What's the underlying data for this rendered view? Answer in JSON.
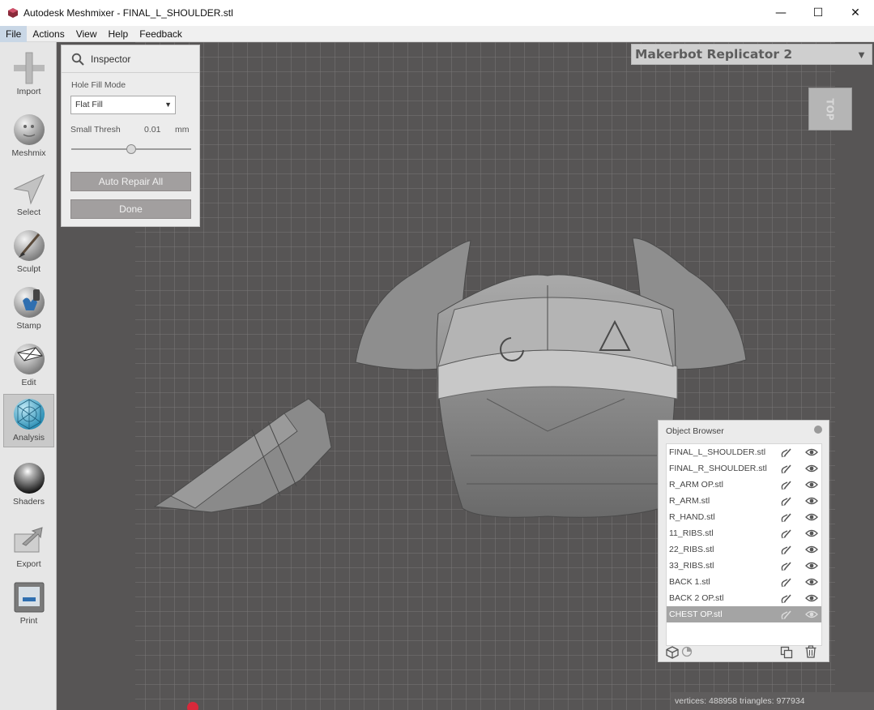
{
  "window": {
    "title": "Autodesk Meshmixer - FINAL_L_SHOULDER.stl",
    "minimize_glyph": "—",
    "maximize_glyph": "☐",
    "close_glyph": "✕"
  },
  "menu": {
    "items": [
      {
        "label": "File",
        "active": true
      },
      {
        "label": "Actions"
      },
      {
        "label": "View"
      },
      {
        "label": "Help"
      },
      {
        "label": "Feedback"
      }
    ]
  },
  "toolbar": {
    "items": [
      {
        "label": "Import",
        "icon": "plus-icon"
      },
      {
        "label": "Meshmix",
        "icon": "meshmix-bunny-icon"
      },
      {
        "label": "Select",
        "icon": "select-arrow-icon"
      },
      {
        "label": "Sculpt",
        "icon": "sculpt-brush-icon"
      },
      {
        "label": "Stamp",
        "icon": "stamp-icon"
      },
      {
        "label": "Edit",
        "icon": "edit-mesh-icon"
      },
      {
        "label": "Analysis",
        "icon": "analysis-mesh-icon",
        "active": true
      },
      {
        "label": "Shaders",
        "icon": "shader-sphere-icon"
      },
      {
        "label": "Export",
        "icon": "export-icon"
      },
      {
        "label": "Print",
        "icon": "print-icon"
      }
    ]
  },
  "printer": {
    "name": "Makerbot Replicator 2",
    "arrow": "▼"
  },
  "viewcube": {
    "face": "TOP"
  },
  "inspector": {
    "title": "Inspector",
    "hole_fill_mode_label": "Hole Fill Mode",
    "hole_fill_mode_value": "Flat Fill",
    "small_thresh_label": "Small Thresh",
    "small_thresh_value": "0.01",
    "small_thresh_unit": "mm",
    "small_thresh_slider_fraction": 0.5,
    "auto_repair_label": "Auto Repair All",
    "done_label": "Done"
  },
  "object_browser": {
    "title": "Object Browser",
    "objects": [
      {
        "name": "FINAL_L_SHOULDER.stl"
      },
      {
        "name": "FINAL_R_SHOULDER.stl"
      },
      {
        "name": "R_ARM OP.stl"
      },
      {
        "name": "R_ARM.stl"
      },
      {
        "name": "R_HAND.stl"
      },
      {
        "name": "11_RIBS.stl"
      },
      {
        "name": "22_RIBS.stl"
      },
      {
        "name": "33_RIBS.stl"
      },
      {
        "name": "BACK 1.stl"
      },
      {
        "name": "BACK 2 OP.stl"
      },
      {
        "name": "CHEST OP.stl",
        "selected": true
      }
    ]
  },
  "status": {
    "text": "vertices: 488958 triangles: 977934"
  },
  "colors": {
    "viewport_bg": "#575555",
    "grid_line": "#7a7878",
    "selected_row": "#a4a4a4",
    "button_bg": "#a29f9f",
    "red_dot": "#d8283a"
  }
}
